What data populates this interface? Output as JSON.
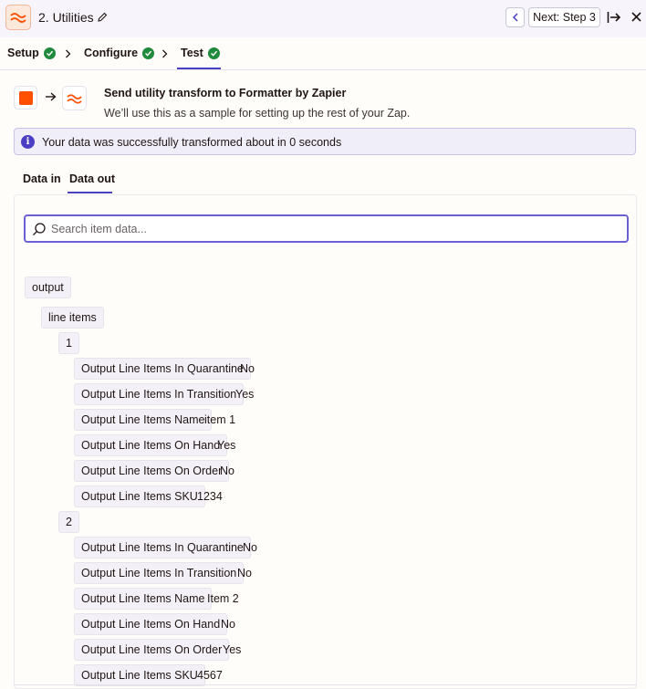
{
  "header": {
    "title": "2. Utilities",
    "next_label": "Next: Step 3",
    "icons": [
      "formatter-icon",
      "pencil-icon",
      "chevron-left-icon",
      "collapse-panel-icon",
      "close-icon"
    ]
  },
  "steps": [
    {
      "label": "Setup",
      "status": "complete"
    },
    {
      "label": "Configure",
      "status": "complete"
    },
    {
      "label": "Test",
      "status": "complete",
      "active": true
    }
  ],
  "action": {
    "title": "Send utility transform to Formatter by Zapier",
    "subtitle": "We’ll use this as a sample for setting up the rest of your Zap."
  },
  "info_banner": {
    "text": "Your data was successfully transformed about in 0 seconds"
  },
  "tabs": [
    {
      "label": "Data in",
      "active": false
    },
    {
      "label": "Data out",
      "active": true
    }
  ],
  "search": {
    "placeholder": "Search item data...",
    "value": ""
  },
  "tree": {
    "root": "output",
    "group": "line items",
    "items": [
      {
        "index": "1",
        "fields": [
          {
            "key": "Output Line Items In Quarantine",
            "value": "No"
          },
          {
            "key": "Output Line Items In Transition",
            "value": "Yes"
          },
          {
            "key": "Output Line Items Name",
            "value": "item 1"
          },
          {
            "key": "Output Line Items On Hand",
            "value": "Yes"
          },
          {
            "key": "Output Line Items On Order",
            "value": "No"
          },
          {
            "key": "Output Line Items SKU",
            "value": "1234"
          }
        ]
      },
      {
        "index": "2",
        "fields": [
          {
            "key": "Output Line Items In Quarantine",
            "value": "No"
          },
          {
            "key": "Output Line Items In Transition",
            "value": "No"
          },
          {
            "key": "Output Line Items Name",
            "value": "Item 2"
          },
          {
            "key": "Output Line Items On Hand",
            "value": "No"
          },
          {
            "key": "Output Line Items On Order",
            "value": "Yes"
          },
          {
            "key": "Output Line Items SKU",
            "value": "4567"
          }
        ]
      }
    ]
  },
  "colors": {
    "accent": "#4b3fc4",
    "brand_orange": "#ff4f00",
    "success_green": "#1f8a3c"
  }
}
